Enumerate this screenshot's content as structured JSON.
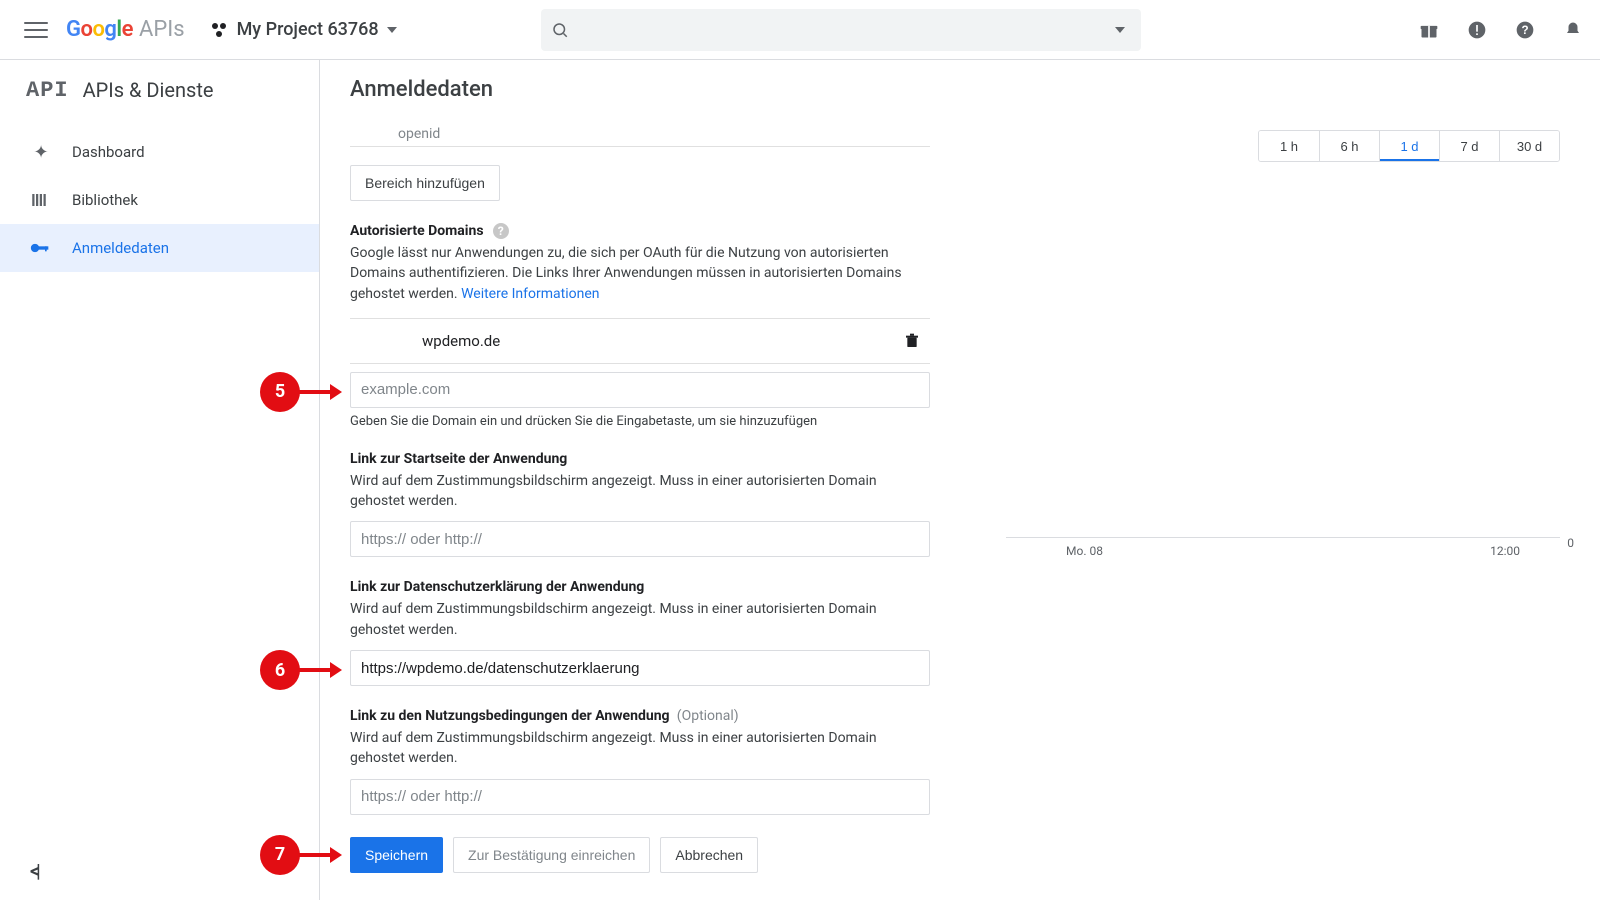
{
  "brand": {
    "product": "APIs",
    "project_label": "My Project 63768"
  },
  "search": {
    "placeholder": ""
  },
  "section": {
    "title": "APIs & Dienste",
    "api_logo": "API"
  },
  "page": {
    "title": "Anmeldedaten"
  },
  "sidebar": {
    "items": [
      {
        "icon": "dashboard",
        "label": "Dashboard"
      },
      {
        "icon": "library",
        "label": "Bibliothek"
      },
      {
        "icon": "key",
        "label": "Anmeldedaten"
      }
    ]
  },
  "form": {
    "openid": "openid",
    "add_scope_btn": "Bereich hinzufügen",
    "auth_domains": {
      "label": "Autorisierte Domains",
      "desc": "Google lässt nur Anwendungen zu, die sich per OAuth für die Nutzung von autorisierten Domains authentifizieren. Die Links Ihrer Anwendungen müssen in autorisierten Domains gehostet werden.",
      "more": "Weitere Informationen",
      "existing": "wpdemo.de",
      "placeholder": "example.com",
      "hint": "Geben Sie die Domain ein und drücken Sie die Eingabetaste, um sie hinzuzufügen"
    },
    "home_link": {
      "label": "Link zur Startseite der Anwendung",
      "desc": "Wird auf dem Zustimmungsbildschirm angezeigt. Muss in einer autorisierten Domain gehostet werden.",
      "placeholder": "https:// oder http://",
      "value": ""
    },
    "privacy_link": {
      "label": "Link zur Datenschutzerklärung der Anwendung",
      "desc": "Wird auf dem Zustimmungsbildschirm angezeigt. Muss in einer autorisierten Domain gehostet werden.",
      "value": "https://wpdemo.de/datenschutzerklaerung"
    },
    "tos_link": {
      "label": "Link zu den Nutzungsbedingungen der Anwendung",
      "optional": "(Optional)",
      "desc": "Wird auf dem Zustimmungsbildschirm angezeigt. Muss in einer autorisierten Domain gehostet werden.",
      "placeholder": "https:// oder http://",
      "value": ""
    },
    "actions": {
      "save": "Speichern",
      "submit": "Zur Bestätigung einreichen",
      "cancel": "Abbrechen"
    }
  },
  "annotations": {
    "a5": "5",
    "a6": "6",
    "a7": "7"
  },
  "range": {
    "items": [
      "1 h",
      "6 h",
      "1 d",
      "7 d",
      "30 d"
    ],
    "active": 2
  },
  "chart_data": {
    "type": "line",
    "title": "",
    "xlabel": "",
    "ylabel": "",
    "ylim": [
      0,
      0
    ],
    "x_ticks": [
      "Mo. 08",
      "12:00"
    ],
    "y_ticks": [
      "0"
    ],
    "series": [
      {
        "name": "",
        "values": []
      }
    ]
  }
}
